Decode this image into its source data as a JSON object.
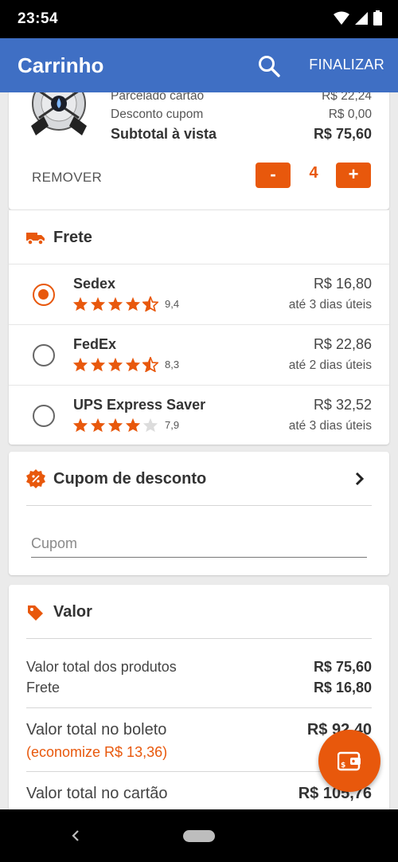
{
  "status_bar": {
    "time": "23:54"
  },
  "app_bar": {
    "title": "Carrinho",
    "finalize_label": "FINALIZAR"
  },
  "product": {
    "parcelado_label": "Parcelado cartão",
    "parcelado_value": "R$ 22,24",
    "desconto_label": "Desconto cupom",
    "desconto_value": "R$ 0,00",
    "subtotal_label": "Subtotal à vista",
    "subtotal_value": "R$ 75,60",
    "remove_label": "REMOVER",
    "minus_label": "-",
    "plus_label": "+",
    "quantity": "4"
  },
  "shipping": {
    "title": "Frete",
    "options": [
      {
        "name": "Sedex",
        "rating": "9,4",
        "stars": 4.5,
        "price": "R$ 16,80",
        "eta": "até 3 dias úteis",
        "selected": true
      },
      {
        "name": "FedEx",
        "rating": "8,3",
        "stars": 4.5,
        "price": "R$ 22,86",
        "eta": "até 2 dias úteis",
        "selected": false
      },
      {
        "name": "UPS Express Saver",
        "rating": "7,9",
        "stars": 4,
        "price": "R$ 32,52",
        "eta": "até 3 dias úteis",
        "selected": false
      }
    ]
  },
  "coupon": {
    "title": "Cupom de desconto",
    "placeholder": "Cupom"
  },
  "summary": {
    "title": "Valor",
    "products_label": "Valor total dos produtos",
    "products_value": "R$ 75,60",
    "freight_label": "Frete",
    "freight_value": "R$ 16,80",
    "boleto_label": "Valor total no boleto",
    "boleto_value": "R$ 92,40",
    "economize": "(economize R$ 13,36)",
    "card_label": "Valor total no cartão",
    "card_value": "R$ 105,76"
  },
  "colors": {
    "app_bar": "#3f6fc4",
    "accent": "#e8580c"
  },
  "icons": [
    "search-icon",
    "truck-icon",
    "star-icon",
    "discount-badge-icon",
    "chevron-right-icon",
    "price-tag-icon",
    "wallet-icon"
  ]
}
